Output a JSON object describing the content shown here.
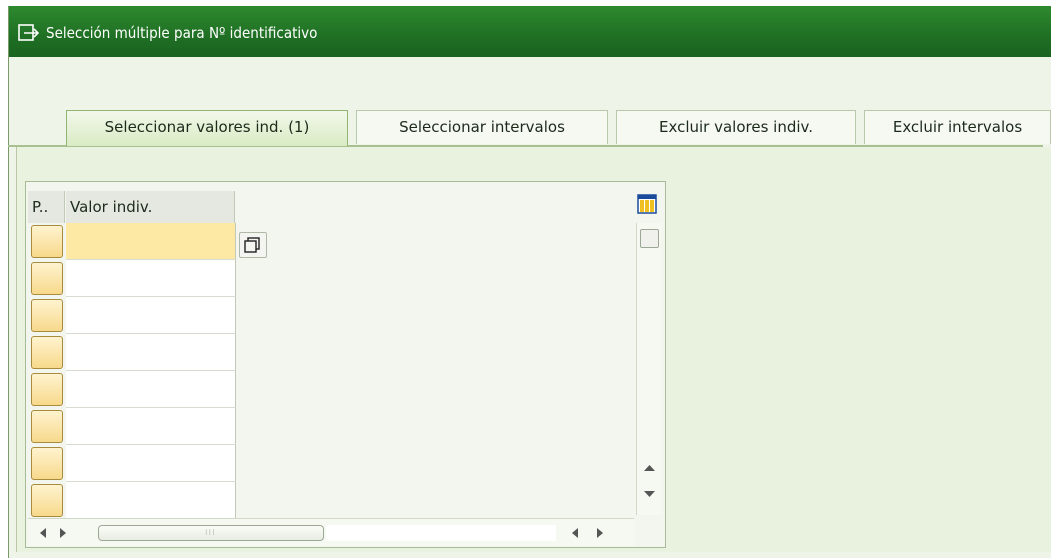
{
  "window": {
    "title": "Selección múltiple para Nº identificativo"
  },
  "tabs": [
    {
      "label": "Seleccionar valores ind. (1)",
      "active": true
    },
    {
      "label": "Seleccionar intervalos",
      "active": false
    },
    {
      "label": "Excluir valores indiv.",
      "active": false
    },
    {
      "label": "Excluir intervalos",
      "active": false
    }
  ],
  "table": {
    "columns": [
      {
        "header": "P.."
      },
      {
        "header": "Valor indiv."
      }
    ],
    "rows": [
      {
        "value": ""
      },
      {
        "value": ""
      },
      {
        "value": ""
      },
      {
        "value": ""
      },
      {
        "value": ""
      },
      {
        "value": ""
      },
      {
        "value": ""
      },
      {
        "value": ""
      }
    ]
  },
  "colors": {
    "titlebar": "#1f6f24",
    "active_tab": "#d9ebc4",
    "row_selector": "#f7d98b",
    "selected_cell": "#fde8a4"
  },
  "icons": {
    "title_icon": "exit-arrow-icon",
    "detail_icon": "value-help-icon",
    "column_config_icon": "column-settings-icon"
  }
}
